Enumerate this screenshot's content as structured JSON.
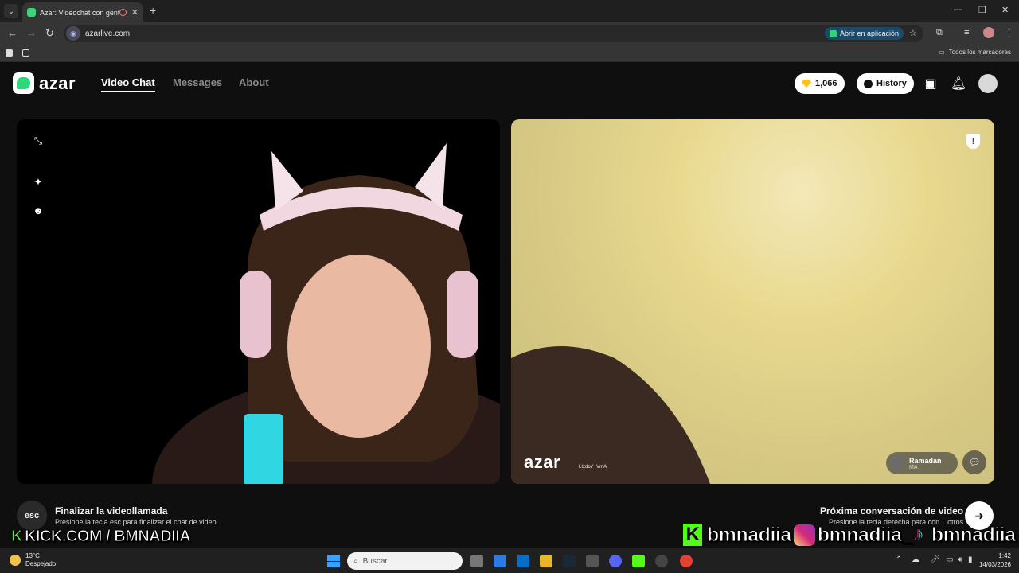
{
  "browser": {
    "tab_title": "Azar: Videochat con gente",
    "url": "azarlive.com",
    "open_in_app": "Abrir en aplicación",
    "all_bookmarks": "Todos los marcadores"
  },
  "header": {
    "logo_text": "azar",
    "nav": [
      "Video Chat",
      "Messages",
      "About"
    ],
    "gems": "1,066",
    "history": "History"
  },
  "video_right": {
    "watermark": "azar",
    "watermark_id": "LIzdoY+VmA",
    "partner_name": "Ramadan",
    "partner_country": "MA"
  },
  "footer_hints": {
    "esc_key": "esc",
    "end_title": "Finalizar la videollamada",
    "end_sub": "Presione la tecla esc para finalizar el chat de video.",
    "next_title": "Próxima conversación de video",
    "next_sub": "Presione la tecla derecha para con... otros"
  },
  "overlay": {
    "kick_text": "KICK.COM / BMNADIIA",
    "handle1": "bmnadiia",
    "handle2": "bmnadiia_",
    "handle3": "bmnadiia"
  },
  "taskbar": {
    "temp": "13°C",
    "condition": "Despejado",
    "search": "Buscar",
    "time": "1:42",
    "date": "14/03/2026"
  },
  "colors": {
    "brand_green": "#2bd97a",
    "kick_green": "#53fc18",
    "gem_gold": "#ffc21a"
  }
}
